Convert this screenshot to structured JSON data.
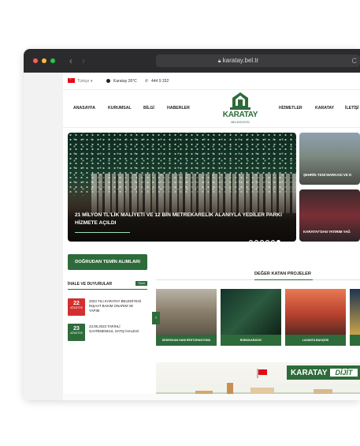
{
  "browser": {
    "url": "karatay.bel.tr",
    "lock_icon": "lock-icon",
    "reload_icon": "reload-icon",
    "traffic_lights": [
      "#ff5f57",
      "#febc2e",
      "#28c840"
    ]
  },
  "topbar": {
    "language": "Türkçe",
    "weather": "Karatay 26°C",
    "phone": "444 9 332"
  },
  "nav": {
    "left": [
      "ANASAYFA",
      "KURUMSAL",
      "BİLGİ",
      "HABERLER"
    ],
    "right": [
      "HİZMETLER",
      "KARATAY",
      "İLETİŞİ"
    ]
  },
  "logo": {
    "name": "KARATAY",
    "sub": "BELEDİYESİ"
  },
  "hero": {
    "title": "21 MİLYON TL'LİK MALİYETİ VE 12 BİN METREKARELİK ALANIYLA YEDİLER PARKI HİZMETE AÇILDI",
    "slide_count": 6
  },
  "side_news": [
    {
      "caption": "ŞEHRİN YENİ MARKASI VE D"
    },
    {
      "caption": "KARATAY'DAN YATIRIM YAĞ"
    }
  ],
  "procurement_button": "DOĞRUDAN TEMİN ALIMLARI",
  "announcements": {
    "title": "İHALE VE DUYURULAR",
    "badge": "Tümü",
    "items": [
      {
        "day": "22",
        "month": "AĞUSTOS",
        "text": "2023 YILI KARATAY BELEDİYESİ İNŞAAT BAKIM ONARIM VE YAPIM",
        "color": "#d32f2f"
      },
      {
        "day": "23",
        "month": "AĞUSTOS",
        "text": "23.08.2023 TARİHLİ GAYRİMENKUL SATIŞ İHALESİ",
        "color": "#2e6b3a"
      }
    ]
  },
  "projects": {
    "title": "DEĞER KATAN PROJELER",
    "items": [
      {
        "caption": "DEDEKKAN HANI RESTORASYONU"
      },
      {
        "caption": "ROBOKARATAY"
      },
      {
        "caption": "LAVANTA BAHÇESİ"
      }
    ]
  },
  "banner": {
    "brand": "KARATAY",
    "word": "DİJİT"
  },
  "colors": {
    "brand_green": "#2e6b3a",
    "date_red": "#d32f2f"
  }
}
